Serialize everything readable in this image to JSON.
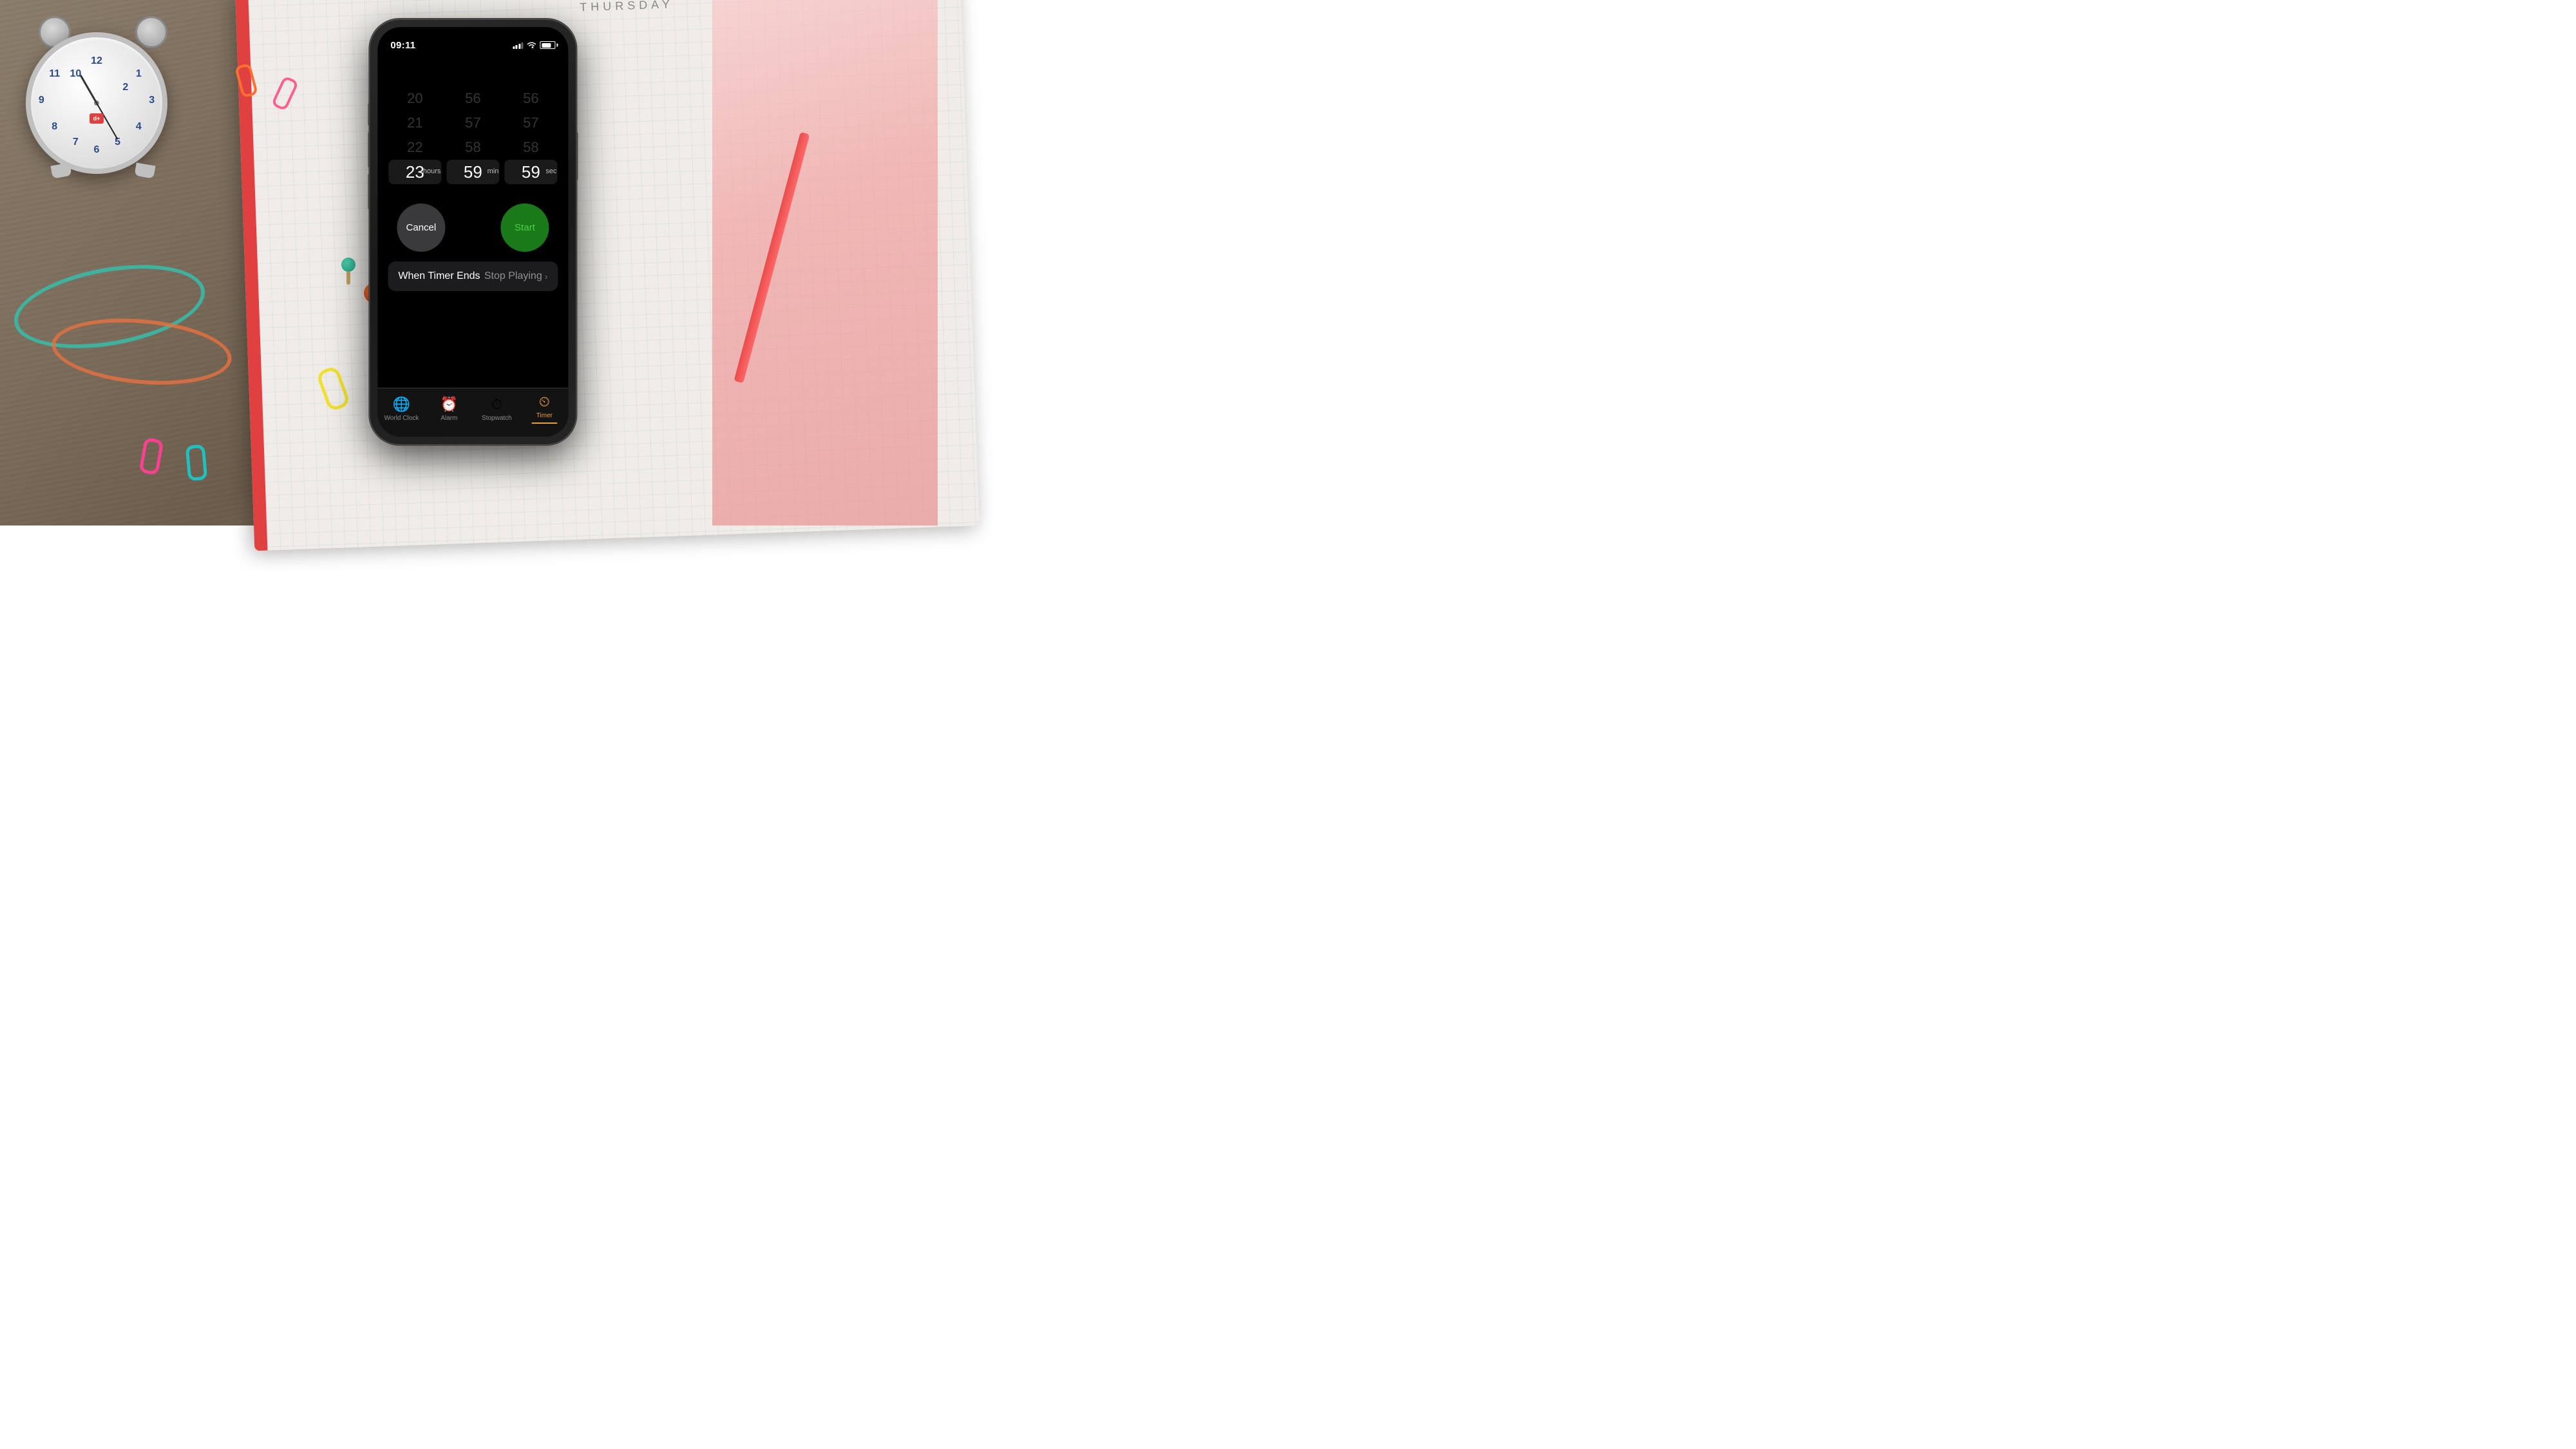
{
  "scene": {
    "notebook_day": "THURSDAY"
  },
  "phone": {
    "status_bar": {
      "time": "09:11"
    },
    "timer": {
      "title": "Timer",
      "picker": {
        "hours": {
          "values_above": [
            "20",
            "21",
            "22"
          ],
          "selected": "23",
          "label": "hours"
        },
        "minutes": {
          "values_above": [
            "56",
            "57",
            "58"
          ],
          "selected": "59",
          "label": "min"
        },
        "seconds": {
          "values_above": [
            "56",
            "57",
            "58"
          ],
          "selected": "59",
          "label": "sec"
        }
      },
      "cancel_button": "Cancel",
      "start_button": "Start",
      "when_timer_ends_label": "When Timer Ends",
      "when_timer_ends_value": "Stop Playing"
    },
    "tab_bar": {
      "items": [
        {
          "id": "world-clock",
          "label": "World Clock",
          "icon": "🌐",
          "active": false
        },
        {
          "id": "alarm",
          "label": "Alarm",
          "icon": "⏰",
          "active": false
        },
        {
          "id": "stopwatch",
          "label": "Stopwatch",
          "icon": "⏱",
          "active": false
        },
        {
          "id": "timer",
          "label": "Timer",
          "icon": "⏲",
          "active": true
        }
      ]
    }
  }
}
